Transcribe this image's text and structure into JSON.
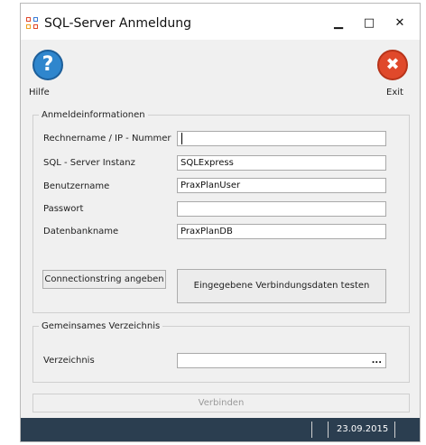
{
  "window": {
    "title": "SQL-Server Anmeldung"
  },
  "window_controls": {
    "minimize": "▁",
    "maximize": "□",
    "close": "✕"
  },
  "toolbar": {
    "help_label": "Hilfe",
    "exit_label": "Exit",
    "help_symbol": "?",
    "exit_symbol": "✖"
  },
  "login_group": {
    "legend": "Anmeldeinformationen",
    "fields": [
      {
        "label": "Rechnername / IP - Nummer",
        "value": ""
      },
      {
        "label": "SQL - Server Instanz",
        "value": "SQLExpress"
      },
      {
        "label": "Benutzername",
        "value": "PraxPlanUser"
      },
      {
        "label": "Passwort",
        "value": ""
      },
      {
        "label": "Datenbankname",
        "value": "PraxPlanDB"
      }
    ],
    "connstring_button": "Connectionstring angeben",
    "test_button": "Eingegebene Verbindungsdaten testen"
  },
  "directory_group": {
    "legend": "Gemeinsames Verzeichnis",
    "label": "Verzeichnis",
    "value": "",
    "browse": "..."
  },
  "connect_button": "Verbinden",
  "status": {
    "date": "23.09.2015"
  },
  "colors": {
    "help_blue": "#2f86cd",
    "exit_red": "#e0492b",
    "statusbar": "#2b3e50"
  }
}
